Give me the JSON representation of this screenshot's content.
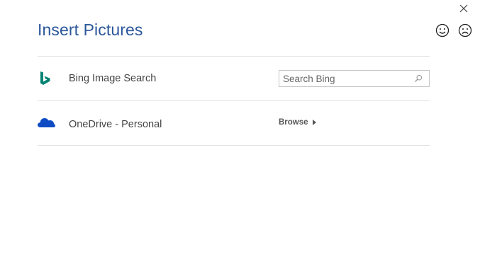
{
  "dialog": {
    "title": "Insert Pictures"
  },
  "window_controls": {
    "close_icon": "close-icon",
    "feedback_smile_icon": "smile-icon",
    "feedback_frown_icon": "frown-icon"
  },
  "sources": [
    {
      "icon": "bing-icon",
      "label": "Bing Image Search",
      "action": {
        "type": "search",
        "placeholder": "Search Bing",
        "value": "",
        "icon": "search-icon"
      }
    },
    {
      "icon": "onedrive-cloud-icon",
      "label": "OneDrive - Personal",
      "action": {
        "type": "browse",
        "label": "Browse",
        "icon": "caret-right-icon"
      }
    }
  ],
  "colors": {
    "title": "#2b579a",
    "bing": "#008373",
    "onedrive": "#0f4cc4",
    "divider": "#e1e1e1"
  }
}
